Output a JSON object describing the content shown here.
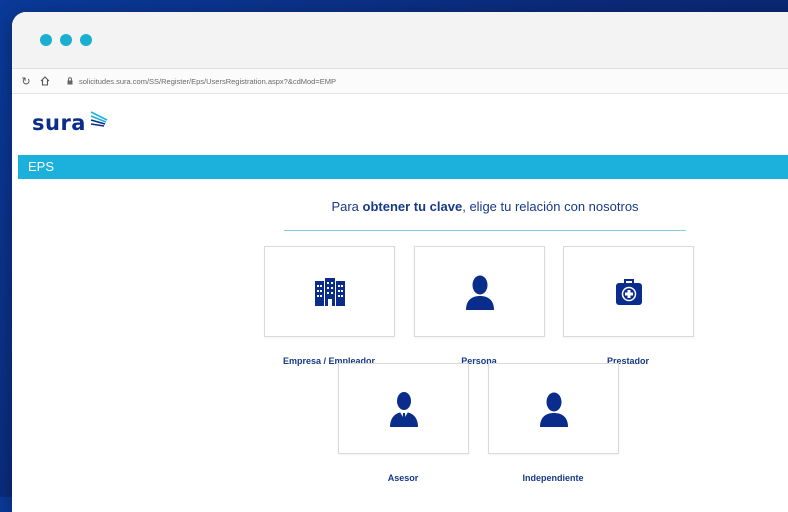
{
  "browser": {
    "url": "solicitudes.sura.com/SS/Register/Eps/UsersRegistration.aspx?&cdMod=EMP"
  },
  "brand": {
    "logo_text": "sura",
    "primary_color": "#0a2c8a",
    "accent_color": "#1cb0dd"
  },
  "header": {
    "section_label": "EPS"
  },
  "main": {
    "heading_prefix": "Para ",
    "heading_bold": "obtener tu clave",
    "heading_suffix": ", elige tu relación con nosotros",
    "options": [
      {
        "label": "Empresa / Empleador",
        "icon": "building-icon"
      },
      {
        "label": "Persona",
        "icon": "person-icon"
      },
      {
        "label": "Prestador",
        "icon": "medical-kit-icon"
      },
      {
        "label": "Asesor",
        "icon": "advisor-icon"
      },
      {
        "label": "Independiente",
        "icon": "person-icon"
      }
    ]
  }
}
